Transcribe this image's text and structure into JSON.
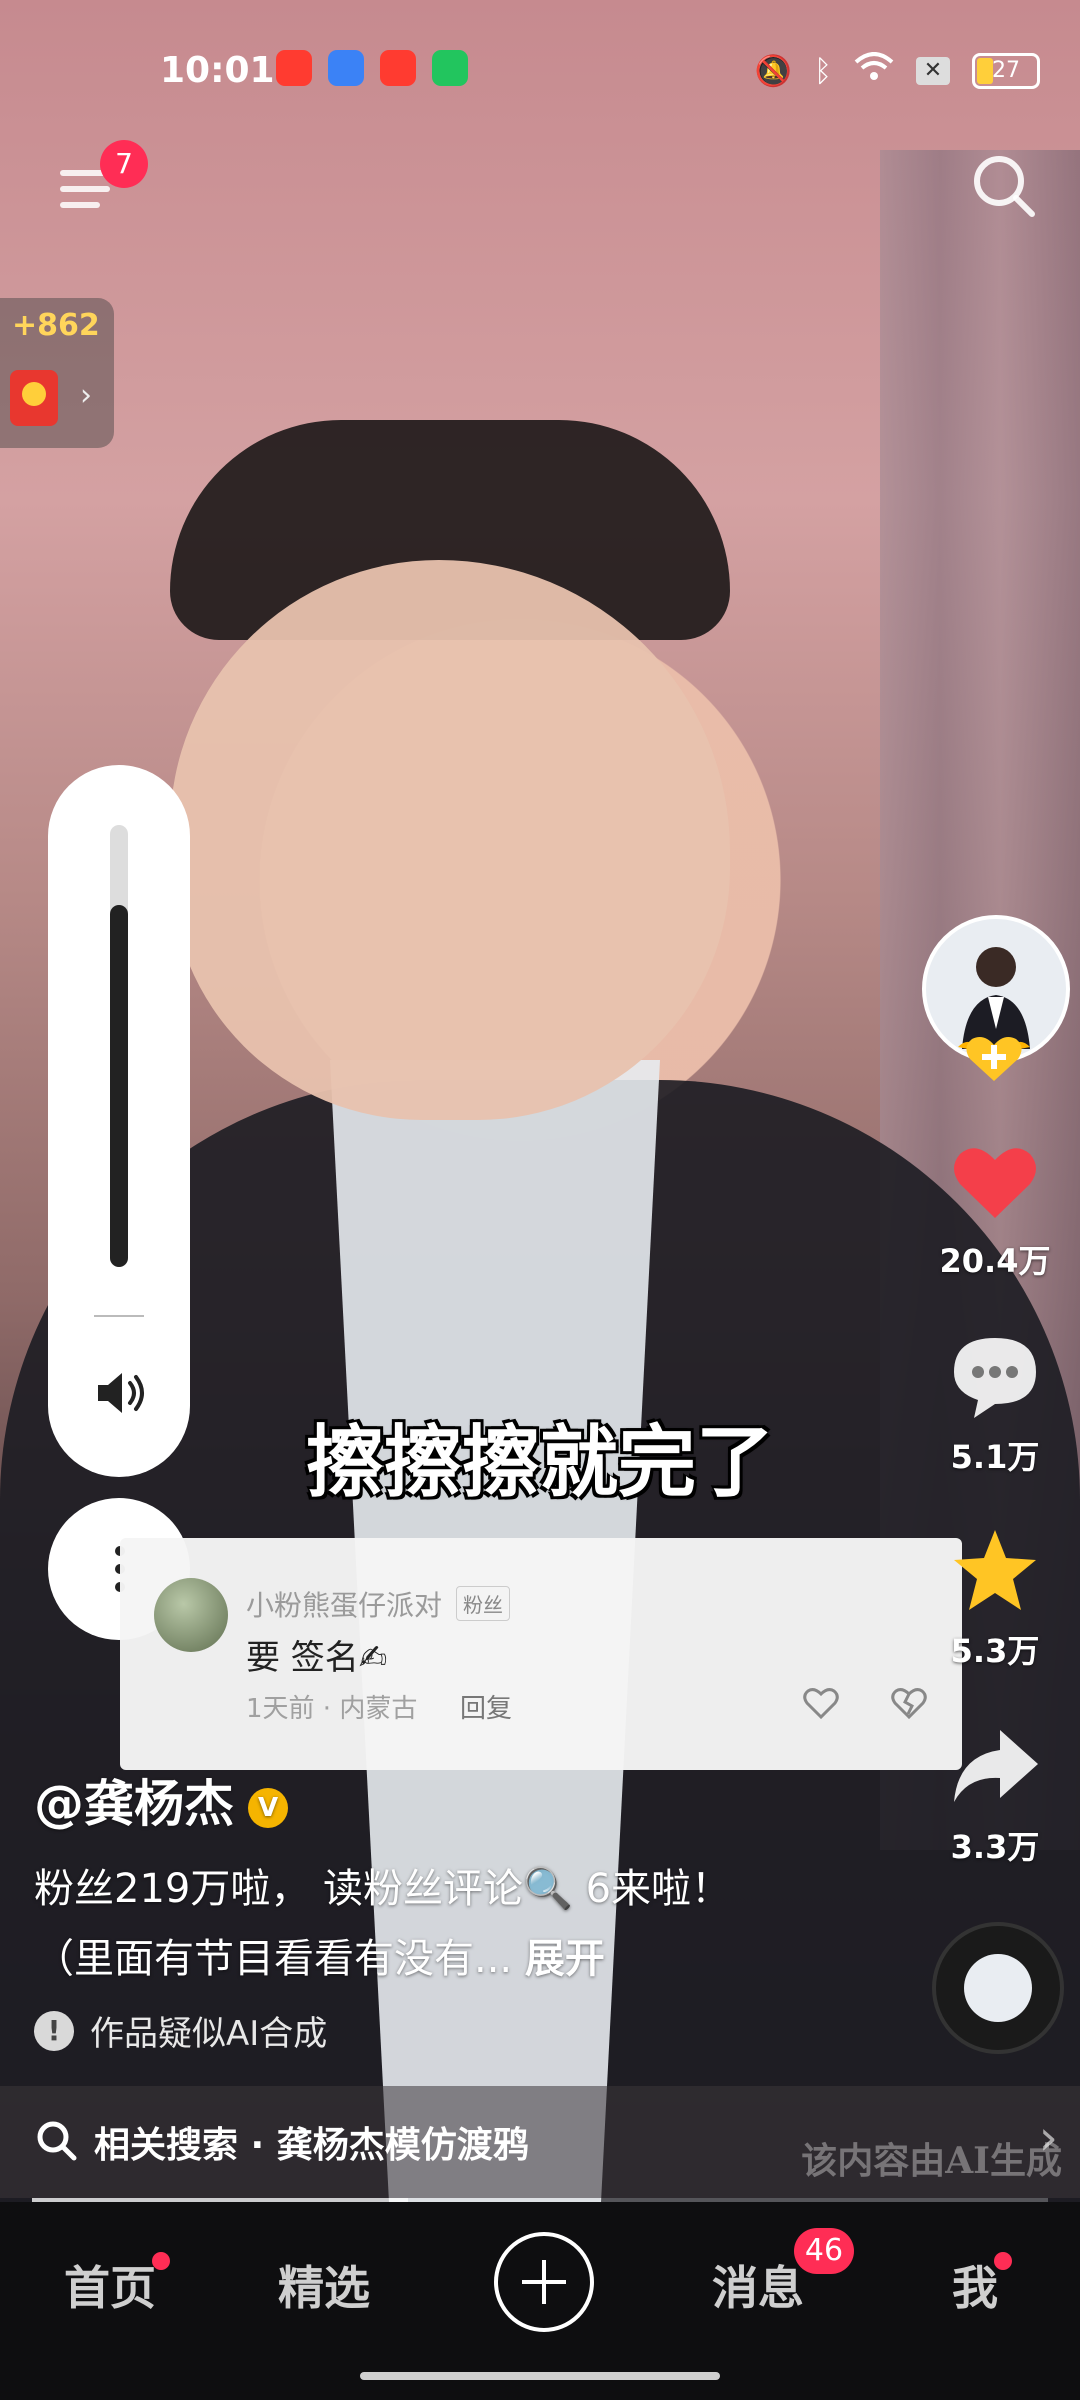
{
  "status_bar": {
    "time": "10:01",
    "app_icons": [
      "taobao-icon",
      "weather-icon",
      "video-icon",
      "security-icon"
    ],
    "indicators": [
      "mute-icon",
      "bluetooth-icon",
      "wifi-icon",
      "sim-off-icon"
    ],
    "battery_level": "27"
  },
  "top_nav": {
    "menu_badge": "7"
  },
  "red_packet": {
    "amount": "+862"
  },
  "volume": {
    "level_percent": 82
  },
  "video": {
    "subtitle": "擦擦擦就完了"
  },
  "comment": {
    "username": "小粉熊蛋仔派对",
    "tag": "粉丝",
    "text": "要 签名✍",
    "meta": "1天前 · 内蒙古",
    "reply_label": "回复"
  },
  "actions": {
    "likes": "20.4万",
    "comments": "5.1万",
    "favorites": "5.3万",
    "shares": "3.3万"
  },
  "caption": {
    "author": "@龚杨杰",
    "description": "粉丝219万啦， 读粉丝评论🔍 6来啦！（里面有节目看看有没有...",
    "expand_label": "展开",
    "ai_notice": "作品疑似AI合成"
  },
  "related_search": {
    "label": "相关搜索 · 龚杨杰模仿渡鸦",
    "watermark": "该内容由AI生成"
  },
  "playback": {
    "progress_percent": 37
  },
  "bottom_nav": {
    "tabs": [
      "首页",
      "精选",
      "消息",
      "我"
    ],
    "messages_badge": "46"
  },
  "colors": {
    "accent_red": "#ff2d55",
    "like_red": "#f43f4a",
    "star_gold": "#ffc524"
  }
}
